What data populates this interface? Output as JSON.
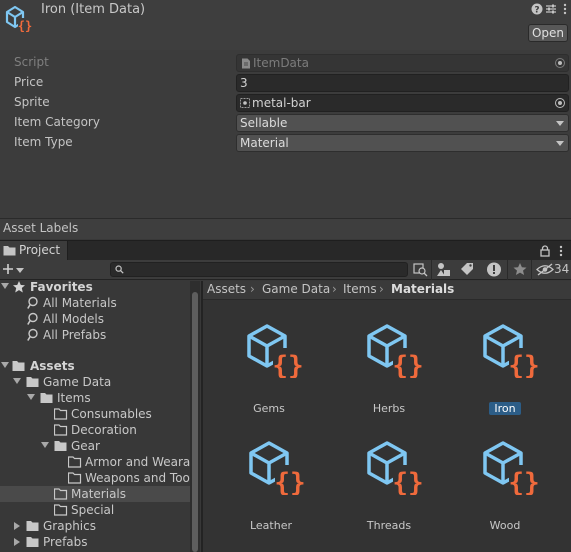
{
  "inspector": {
    "title": "Iron (Item Data)",
    "open_label": "Open",
    "properties": [
      {
        "label": "Script",
        "value": "ItemData",
        "disabled": true
      },
      {
        "label": "Price",
        "value": "3"
      },
      {
        "label": "Sprite",
        "value": "metal-bar"
      },
      {
        "label": "Item Category",
        "value": "Sellable"
      },
      {
        "label": "Item Type",
        "value": "Material"
      }
    ],
    "asset_labels": "Asset Labels"
  },
  "project": {
    "tab_label": "Project",
    "hidden_count": "34",
    "search_placeholder": "",
    "favorites": {
      "label": "Favorites",
      "items": [
        "All Materials",
        "All Models",
        "All Prefabs"
      ]
    },
    "tree": {
      "assets": "Assets",
      "game_data": "Game Data",
      "items": "Items",
      "consumables": "Consumables",
      "decoration": "Decoration",
      "gear": "Gear",
      "armor": "Armor and Wearab",
      "weapons": "Weapons and Tool",
      "materials": "Materials",
      "special": "Special",
      "graphics": "Graphics",
      "prefabs": "Prefabs"
    },
    "breadcrumb": [
      "Assets",
      "Game Data",
      "Items",
      "Materials"
    ],
    "assets": [
      {
        "name": "Gems"
      },
      {
        "name": "Herbs"
      },
      {
        "name": "Iron",
        "selected": true
      },
      {
        "name": "Leather"
      },
      {
        "name": "Threads"
      },
      {
        "name": "Wood"
      }
    ]
  },
  "colors": {
    "cube": "#7fc7f2",
    "braces": "#ef6a3c",
    "selection": "#2c5d87"
  }
}
